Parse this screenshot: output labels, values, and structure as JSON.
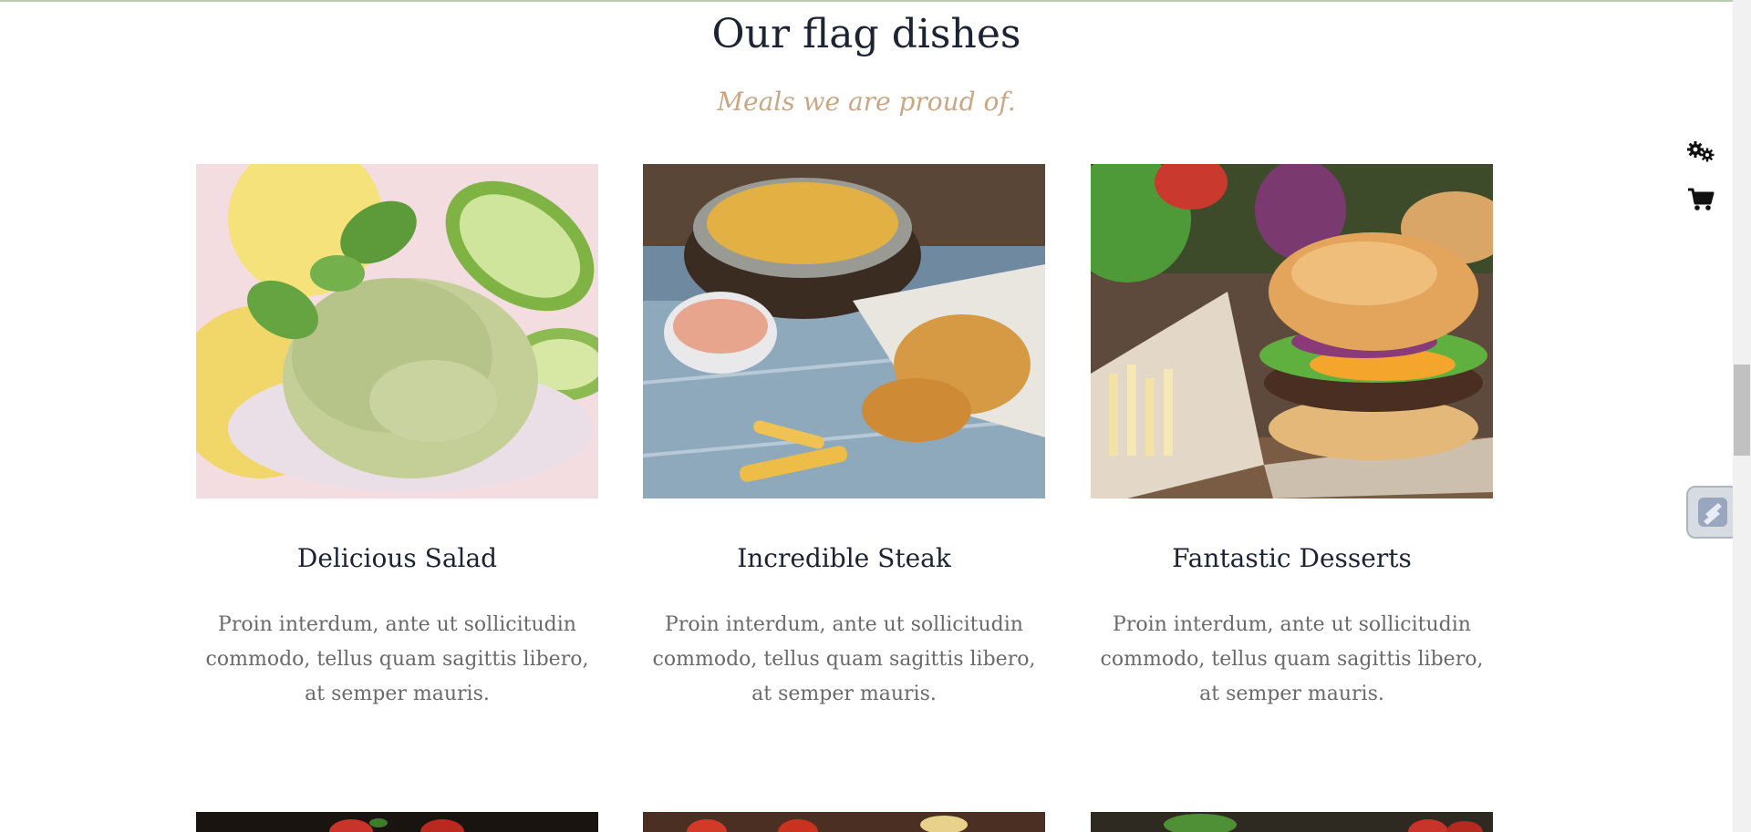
{
  "section": {
    "title": "Our flag dishes",
    "subtitle": "Meals we are proud of."
  },
  "dishes": [
    {
      "name": "Delicious Salad",
      "description": "Proin interdum, ante ut sollicitudin commodo, tellus quam sagittis libero, at semper mauris.",
      "image_icon": "ice-cream-photo"
    },
    {
      "name": "Incredible Steak",
      "description": "Proin interdum, ante ut sollicitudin commodo, tellus quam sagittis libero, at semper mauris.",
      "image_icon": "fish-and-chips-photo"
    },
    {
      "name": "Fantastic Desserts",
      "description": "Proin interdum, ante ut sollicitudin commodo, tellus quam sagittis libero, at semper mauris.",
      "image_icon": "burger-photo"
    }
  ],
  "side_tools": {
    "settings_icon": "gears-icon",
    "cart_icon": "cart-icon"
  },
  "colors": {
    "title": "#1c2333",
    "subtitle": "#c8a784",
    "body_text": "#6a6a6a",
    "top_line": "#b9cdb4"
  }
}
